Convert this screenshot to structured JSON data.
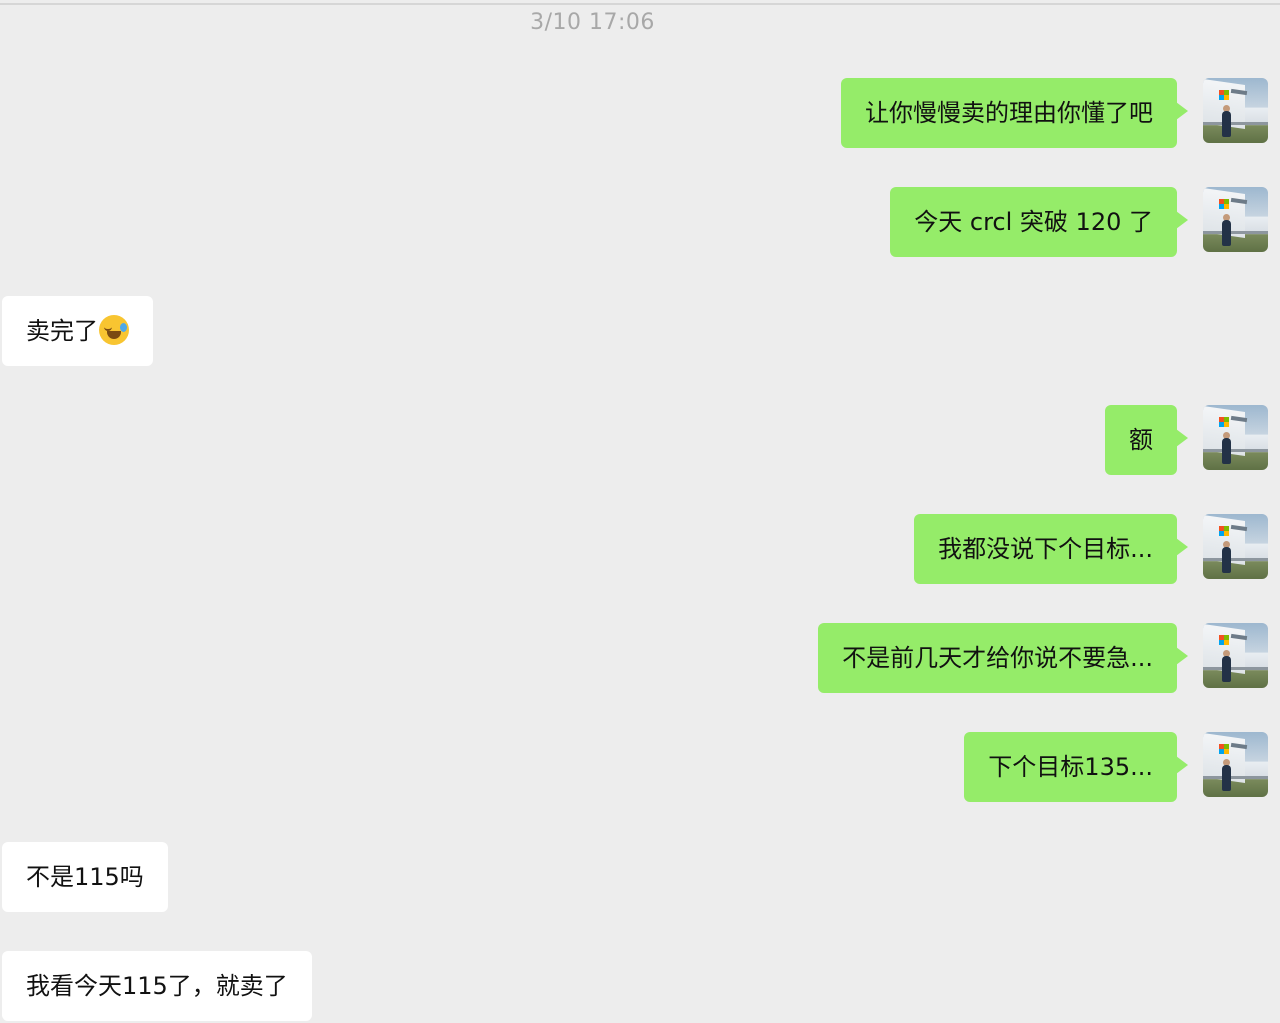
{
  "timestamp": "3/10 17:06",
  "messages": [
    {
      "side": "out",
      "text": "让你慢慢卖的理由你懂了吧"
    },
    {
      "side": "out",
      "text": "今天 crcl 突破 120 了"
    },
    {
      "side": "in",
      "text": "卖完了",
      "emoji": "rolling-on-floor-laughing-emoji-icon"
    },
    {
      "side": "out",
      "text": "额"
    },
    {
      "side": "out",
      "text": "我都没说下个目标..."
    },
    {
      "side": "out",
      "text": "不是前几天才给你说不要急..."
    },
    {
      "side": "out",
      "text": "下个目标135..."
    },
    {
      "side": "in",
      "text": "不是115吗"
    },
    {
      "side": "in",
      "text": "我看今天115了，就卖了"
    }
  ],
  "colors": {
    "background": "#ededed",
    "outgoing_bubble": "#95ec69",
    "incoming_bubble": "#ffffff",
    "timestamp": "#a8a8a8"
  },
  "avatar": {
    "icon": "user-avatar-icon"
  }
}
